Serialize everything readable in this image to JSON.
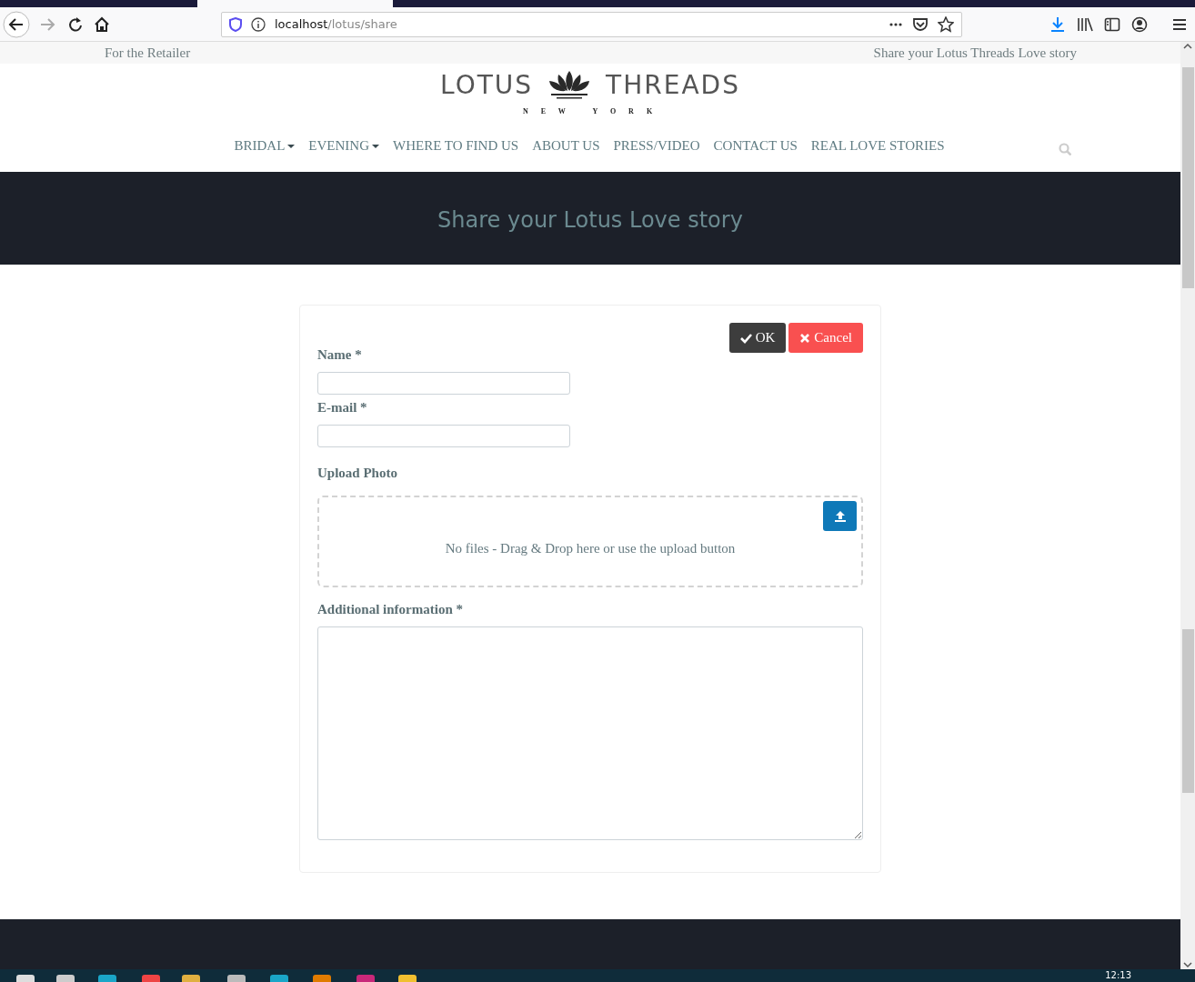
{
  "browser": {
    "url_host": "localhost",
    "url_path": "/lotus/share"
  },
  "top_bar": {
    "left": "For the Retailer",
    "right": "Share your Lotus Threads Love story"
  },
  "logo": {
    "word_1": "LOTUS",
    "word_2": "THREADS",
    "subtitle": "N E W   Y O R K"
  },
  "nav": [
    {
      "label": "BRIDAL",
      "dropdown": true
    },
    {
      "label": "EVENING",
      "dropdown": true
    },
    {
      "label": "WHERE TO FIND US",
      "dropdown": false
    },
    {
      "label": "ABOUT US",
      "dropdown": false
    },
    {
      "label": "PRESS/VIDEO",
      "dropdown": false
    },
    {
      "label": "CONTACT US",
      "dropdown": false
    },
    {
      "label": "REAL LOVE STORIES",
      "dropdown": false
    }
  ],
  "banner": {
    "title": "Share your Lotus Love story"
  },
  "form": {
    "buttons": [
      {
        "label": "OK",
        "kind": "ok"
      },
      {
        "label": "Cancel",
        "kind": "cancel"
      }
    ],
    "fields": [
      {
        "kind": "text",
        "label": "Name *"
      },
      {
        "kind": "text",
        "label": "E-mail *"
      },
      {
        "kind": "upload",
        "label": "Upload Photo",
        "hint": "No files - Drag & Drop here or use the upload button"
      },
      {
        "kind": "textarea",
        "label": "Additional information *"
      }
    ]
  },
  "taskbar": {
    "clock": "12:13"
  }
}
